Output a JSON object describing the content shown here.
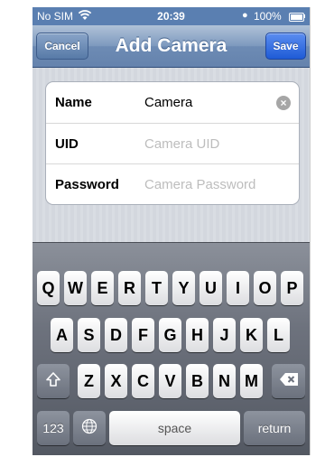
{
  "status_bar": {
    "carrier": "No SIM",
    "time": "20:39",
    "battery_percent": "100%",
    "wifi_icon": "wifi-icon",
    "alarm_icon": "alarm-icon",
    "battery_icon": "battery-icon"
  },
  "nav": {
    "title": "Add Camera",
    "cancel_label": "Cancel",
    "save_label": "Save"
  },
  "form": {
    "rows": [
      {
        "label": "Name",
        "value": "Camera",
        "placeholder": ""
      },
      {
        "label": "UID",
        "value": "",
        "placeholder": "Camera UID"
      },
      {
        "label": "Password",
        "value": "",
        "placeholder": "Camera Password"
      }
    ]
  },
  "keyboard": {
    "row1": [
      "Q",
      "W",
      "E",
      "R",
      "T",
      "Y",
      "U",
      "I",
      "O",
      "P"
    ],
    "row2": [
      "A",
      "S",
      "D",
      "F",
      "G",
      "H",
      "J",
      "K",
      "L"
    ],
    "row3": [
      "Z",
      "X",
      "C",
      "V",
      "B",
      "N",
      "M"
    ],
    "numbers_label": "123",
    "space_label": "space",
    "return_label": "return",
    "shift_icon": "shift-icon",
    "globe_icon": "globe-icon",
    "delete_icon": "delete-icon"
  },
  "colors": {
    "nav_blue": "#6d8bb4",
    "save_blue": "#1e5bd6",
    "keyboard_dark": "#6d727d"
  }
}
